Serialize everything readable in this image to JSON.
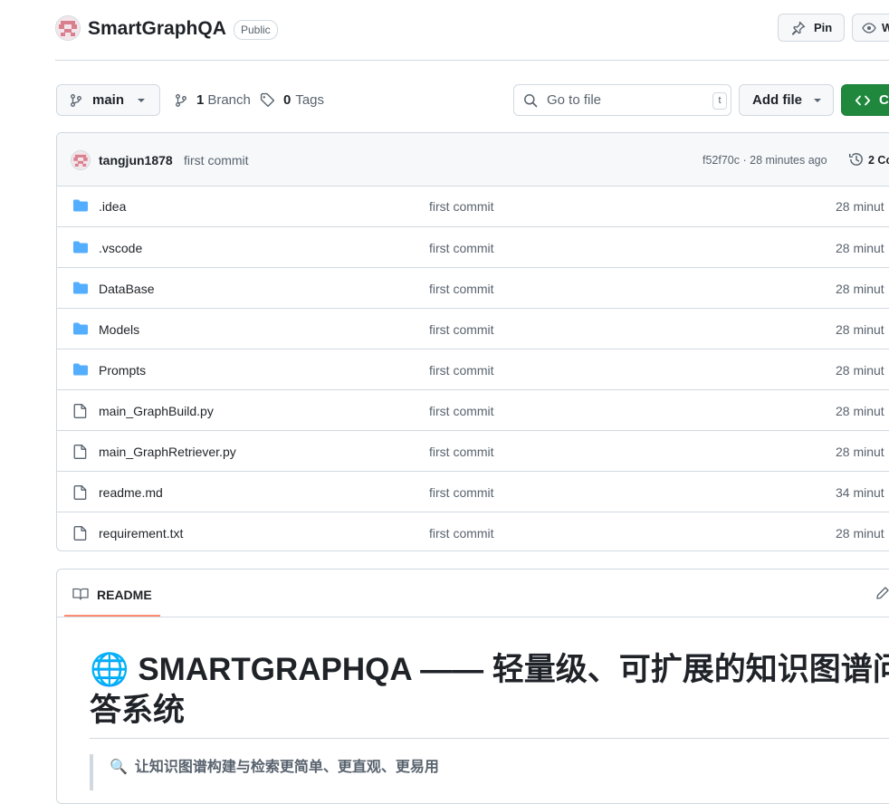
{
  "repo": {
    "name": "SmartGraphQA",
    "visibility": "Public",
    "pin_label": "Pin",
    "watch_label": "W"
  },
  "toolbar": {
    "branch": "main",
    "branches_count": "1",
    "branches_label": "Branch",
    "tags_count": "0",
    "tags_label": "Tags",
    "search_placeholder": "Go to file",
    "search_shortcut": "t",
    "add_file_label": "Add file",
    "code_label": "Co"
  },
  "latest_commit": {
    "author": "tangjun1878",
    "message": "first commit",
    "hash_time": "f52f70c · 28 minutes ago",
    "commits_label": "2 Co"
  },
  "files": [
    {
      "type": "folder",
      "name": ".idea",
      "commit": "first commit",
      "time": "28 minut"
    },
    {
      "type": "folder",
      "name": ".vscode",
      "commit": "first commit",
      "time": "28 minut"
    },
    {
      "type": "folder",
      "name": "DataBase",
      "commit": "first commit",
      "time": "28 minut"
    },
    {
      "type": "folder",
      "name": "Models",
      "commit": "first commit",
      "time": "28 minut"
    },
    {
      "type": "folder",
      "name": "Prompts",
      "commit": "first commit",
      "time": "28 minut"
    },
    {
      "type": "file",
      "name": "main_GraphBuild.py",
      "commit": "first commit",
      "time": "28 minut"
    },
    {
      "type": "file",
      "name": "main_GraphRetriever.py",
      "commit": "first commit",
      "time": "28 minut"
    },
    {
      "type": "file",
      "name": "readme.md",
      "commit": "first commit",
      "time": "34 minut"
    },
    {
      "type": "file",
      "name": "requirement.txt",
      "commit": "first commit",
      "time": "28 minut"
    }
  ],
  "readme": {
    "tab_label": "README",
    "heading_emoji": "🌐",
    "heading": "SMARTGRAPHQA —— 轻量级、可扩展的知识图谱问答系统",
    "quote_emoji": "🔍",
    "quote": "让知识图谱构建与检索更简单、更直观、更易用"
  },
  "colors": {
    "folder": "#54aeff",
    "primary_button": "#1f883d",
    "tab_underline": "#fd8c73"
  }
}
